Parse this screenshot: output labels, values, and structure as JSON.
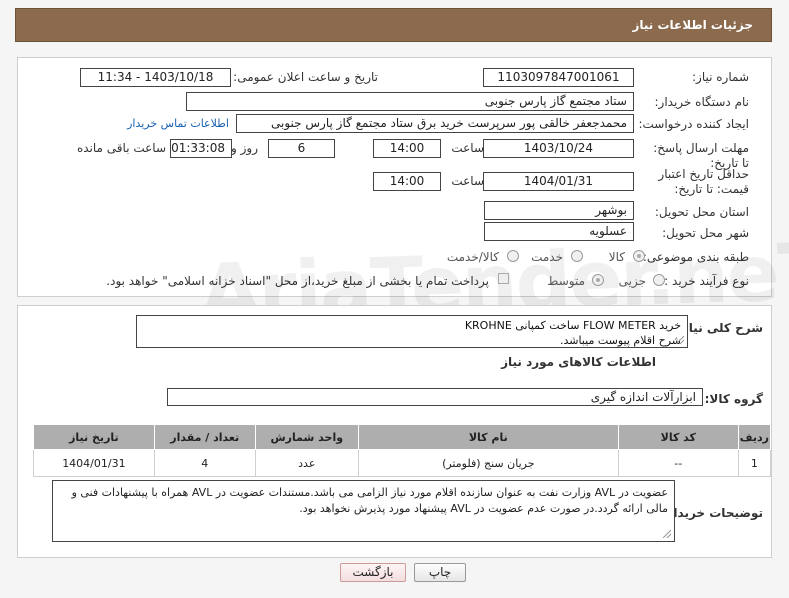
{
  "header": {
    "title": "جزئیات اطلاعات نیاز"
  },
  "form": {
    "need_number_label": "شماره نیاز:",
    "need_number": "1103097847001061",
    "announce_label": "تاریخ و ساعت اعلان عمومی:",
    "announce_value": "1403/10/18 - 11:34",
    "buyer_org_label": "نام دستگاه خریدار:",
    "buyer_org": "ستاد مجتمع گاز پارس جنوبی",
    "creator_label": "ایجاد کننده درخواست:",
    "creator": "محمدجعفر خالقی پور سرپرست خرید برق ستاد مجتمع گاز پارس جنوبی",
    "contact_link": "اطلاعات تماس خریدار",
    "deadline_label": "مهلت ارسال پاسخ: تا تاریخ:",
    "deadline_date": "1403/10/24",
    "time_label": "ساعت",
    "deadline_time": "14:00",
    "days": "6",
    "days_label": "روز و",
    "remaining": "01:33:08",
    "remaining_label": "ساعت باقی مانده",
    "validity_label": "حداقل تاریخ اعتبار قیمت: تا تاریخ:",
    "validity_date": "1404/01/31",
    "validity_time": "14:00",
    "province_label": "استان محل تحویل:",
    "province": "بوشهر",
    "city_label": "شهر محل تحویل:",
    "city": "عسلویه",
    "category_label": "طبقه بندی موضوعی:",
    "category_options": [
      "کالا",
      "خدمت",
      "کالا/خدمت"
    ],
    "process_label": "نوع فرآیند خرید :",
    "process_options": [
      "جزیی",
      "متوسط"
    ],
    "payment_note": "پرداخت تمام یا بخشی از مبلغ خرید،از محل \"اسناد خزانه اسلامی\" خواهد بود."
  },
  "description": {
    "label": "شرح کلی نیاز:",
    "line1": "خرید FLOW METER  ساخت کمپانی KROHNE",
    "line2": "شرح اقلام پیوست میباشد."
  },
  "goods": {
    "section_title": "اطلاعات کالاهای مورد نیاز",
    "group_label": "گروه کالا:",
    "group_value": "ابزارآلات اندازه گیری",
    "columns": [
      "ردیف",
      "کد کالا",
      "نام کالا",
      "واحد شمارش",
      "تعداد / مقدار",
      "تاریخ نیاز"
    ],
    "rows": [
      [
        "1",
        "--",
        "جریان سنج (فلومتر)",
        "عدد",
        "4",
        "1404/01/31"
      ]
    ]
  },
  "buyer_notes": {
    "label": "توضیحات خریدار:",
    "text": "عضویت در AVL وزارت نفت به عنوان سازنده اقلام مورد نیاز الزامی می باشد.مستندات عضویت در AVL همراه با پیشنهادات فنی و مالی ارائه گردد.در صورت عدم عضویت در AVL پیشنهاد مورد پذیرش نخواهد بود."
  },
  "buttons": {
    "print": "چاپ",
    "back": "بازگشت"
  },
  "watermark": "AriaTender.neT"
}
